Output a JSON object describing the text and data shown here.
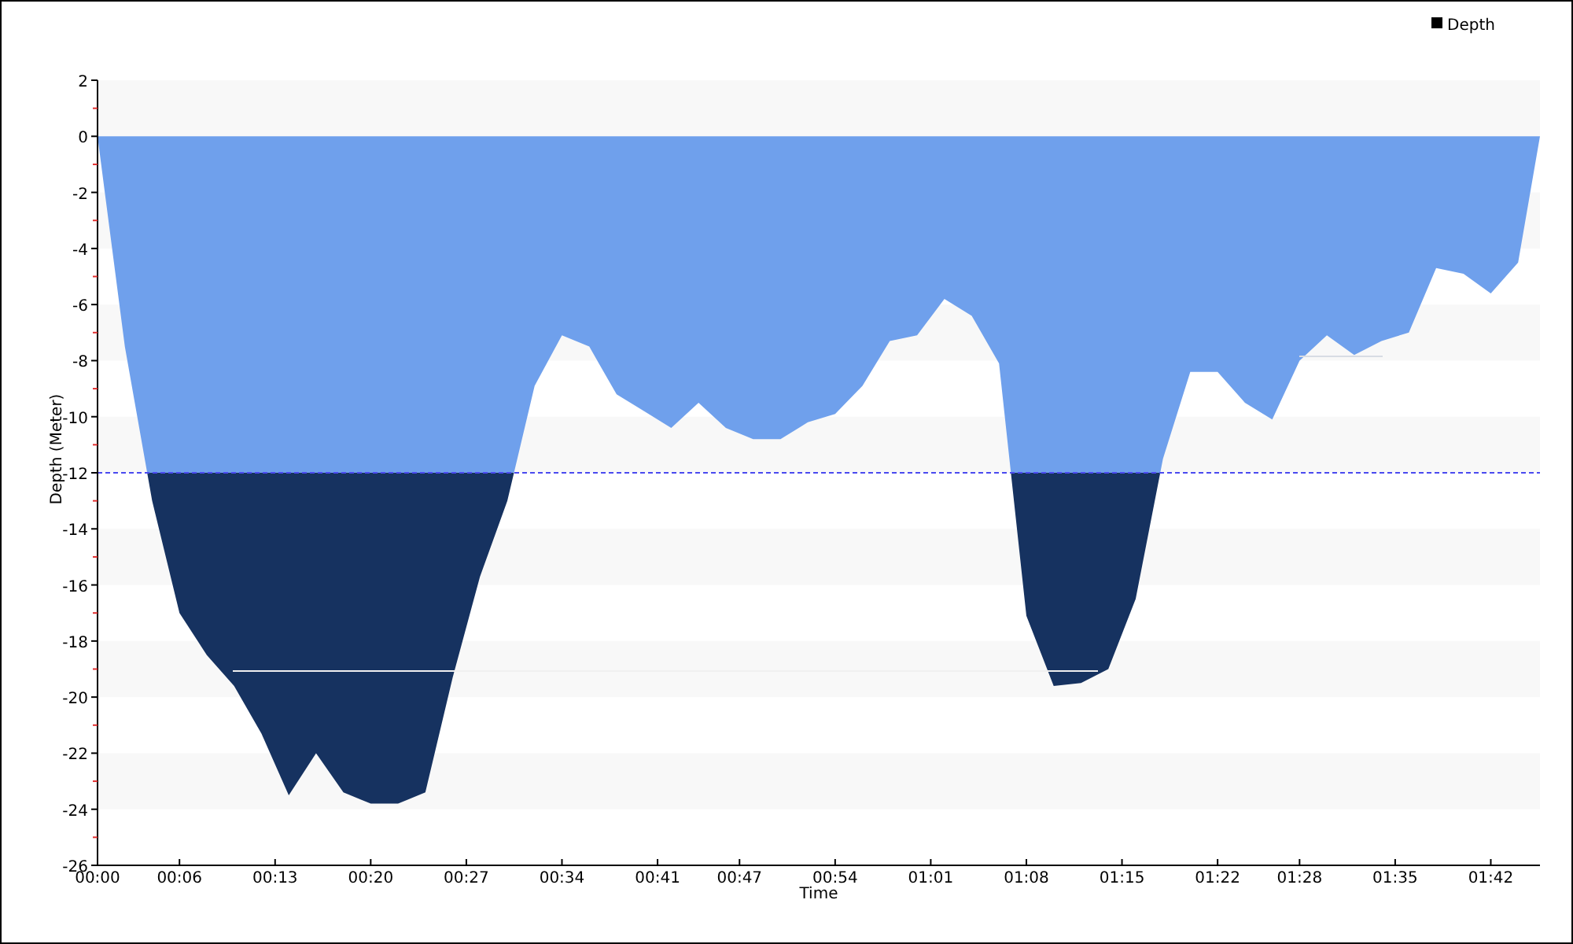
{
  "chart": {
    "chart_data": {
      "type": "area",
      "xlabel": "Time",
      "ylabel": "Depth (Meter)",
      "x": [
        0,
        2,
        4,
        6,
        8,
        10,
        12,
        14,
        16,
        18,
        20,
        22,
        24,
        26,
        28,
        30,
        32,
        34,
        36,
        38,
        40,
        42,
        44,
        46,
        48,
        50,
        52,
        54,
        56,
        58,
        60,
        62,
        64,
        66,
        68,
        70,
        72,
        74,
        76,
        78,
        80,
        82,
        84,
        86,
        88,
        90,
        92,
        94,
        96,
        98,
        100,
        102,
        104,
        105.6
      ],
      "series": [
        {
          "name": "Depth",
          "color": "#6fa0ec",
          "values": [
            0,
            -7.5,
            -13.0,
            -17.0,
            -18.5,
            -19.6,
            -21.3,
            -23.5,
            -22.0,
            -23.4,
            -23.8,
            -23.8,
            -23.4,
            -19.3,
            -15.7,
            -13.0,
            -8.9,
            -7.1,
            -7.5,
            -9.2,
            -9.8,
            -10.4,
            -9.5,
            -10.4,
            -10.8,
            -10.8,
            -10.2,
            -9.9,
            -8.9,
            -7.3,
            -7.1,
            -5.8,
            -6.4,
            -8.1,
            -17.1,
            -19.6,
            -19.5,
            -19.0,
            -16.5,
            -11.5,
            -8.4,
            -8.4,
            -9.5,
            -10.1,
            -8.0,
            -7.1,
            -7.8,
            -7.3,
            -7.0,
            -4.7,
            -4.9,
            -5.6,
            -4.5,
            0
          ]
        }
      ],
      "xlim": [
        0,
        105.6
      ],
      "ylim": [
        -26,
        2
      ],
      "xticks": [
        {
          "value": 0,
          "label": "00:00"
        },
        {
          "value": 6,
          "label": "00:06"
        },
        {
          "value": 13,
          "label": "00:13"
        },
        {
          "value": 20,
          "label": "00:20"
        },
        {
          "value": 27,
          "label": "00:27"
        },
        {
          "value": 34,
          "label": "00:34"
        },
        {
          "value": 41,
          "label": "00:41"
        },
        {
          "value": 47,
          "label": "00:47"
        },
        {
          "value": 54,
          "label": "00:54"
        },
        {
          "value": 61,
          "label": "01:01"
        },
        {
          "value": 68,
          "label": "01:08"
        },
        {
          "value": 75,
          "label": "01:15"
        },
        {
          "value": 82,
          "label": "01:22"
        },
        {
          "value": 88,
          "label": "01:28"
        },
        {
          "value": 95,
          "label": "01:35"
        },
        {
          "value": 102,
          "label": "01:42"
        }
      ],
      "yticks": [
        2,
        0,
        -2,
        -4,
        -6,
        -8,
        -10,
        -12,
        -14,
        -16,
        -18,
        -20,
        -22,
        -24,
        -26
      ],
      "ref_lines": [
        {
          "axis": "y",
          "value": -12
        }
      ]
    }
  }
}
